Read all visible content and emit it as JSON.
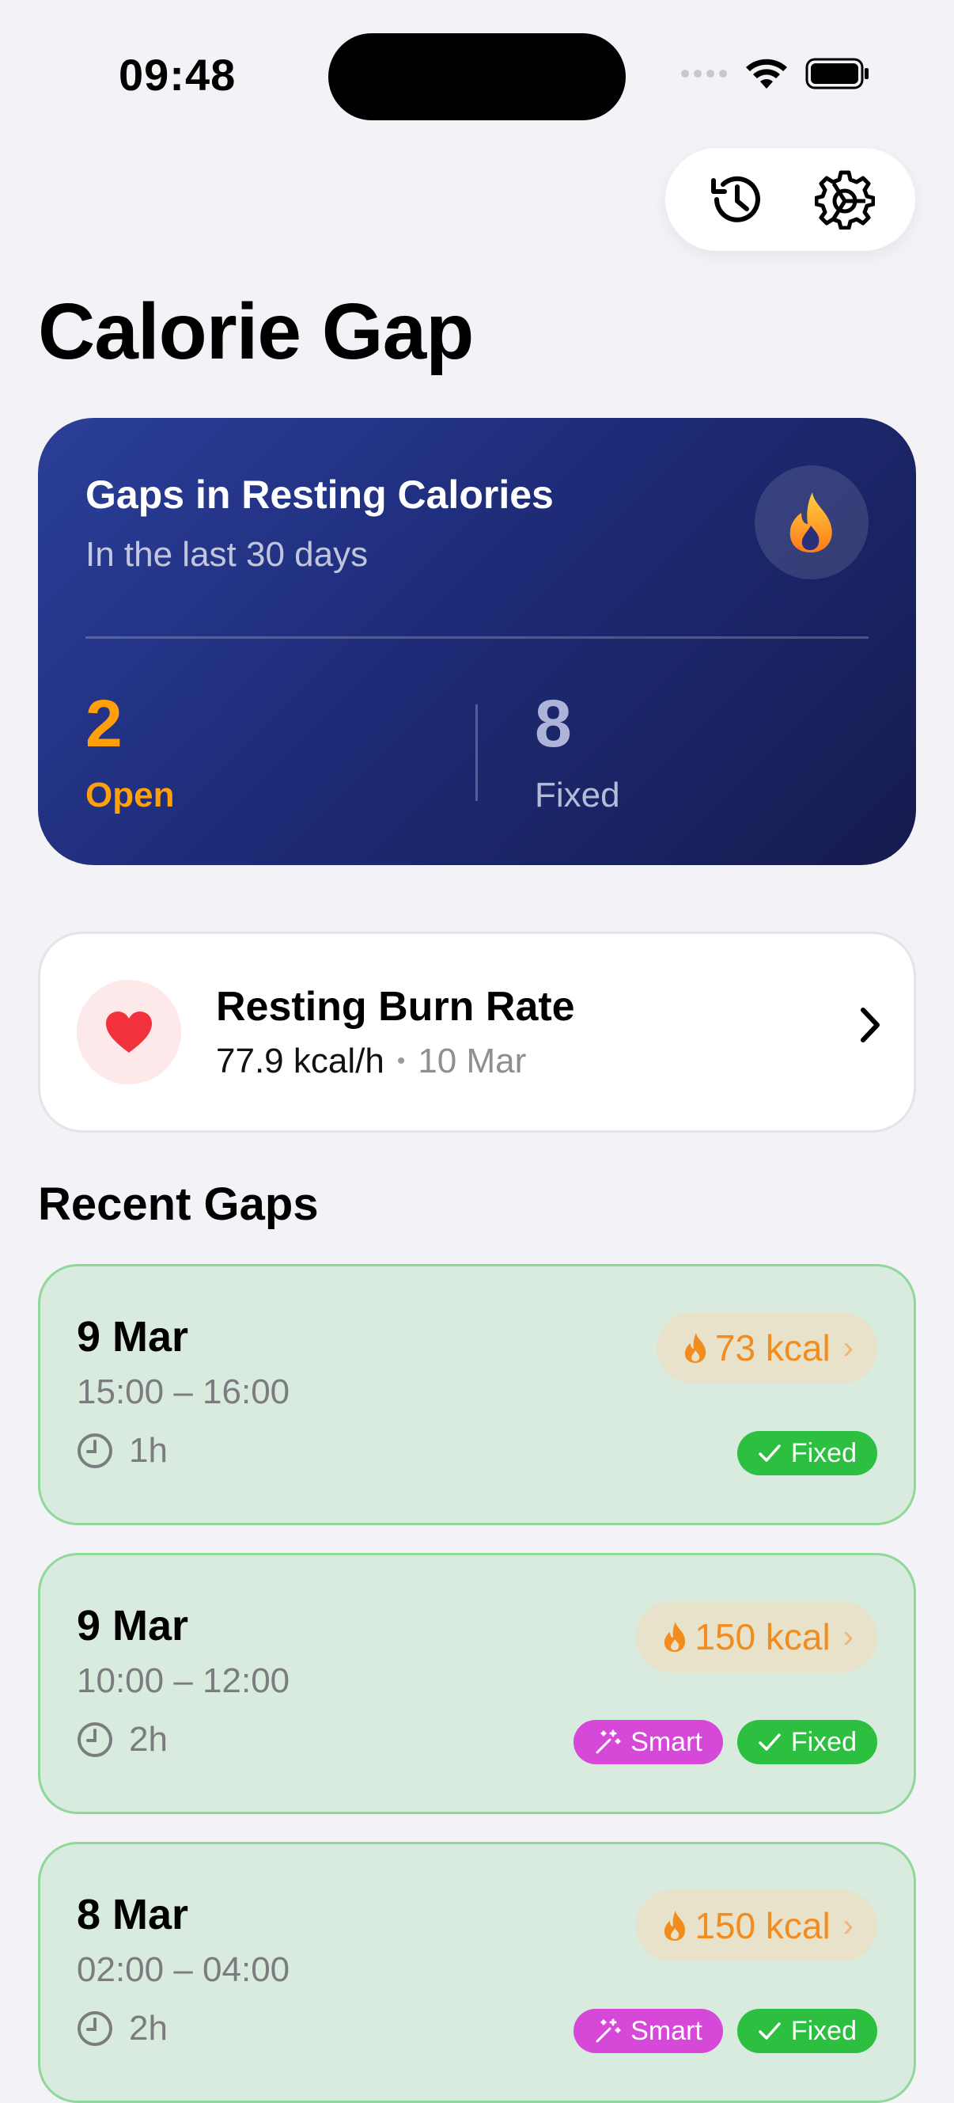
{
  "status_bar": {
    "time": "09:48"
  },
  "page": {
    "title": "Calorie Gap"
  },
  "summary": {
    "title": "Gaps in Resting Calories",
    "subtitle": "In the last 30 days",
    "open_value": "2",
    "open_label": "Open",
    "fixed_value": "8",
    "fixed_label": "Fixed"
  },
  "burn_rate": {
    "title": "Resting Burn Rate",
    "value": "77.9 kcal/h",
    "separator": "•",
    "date": "10 Mar"
  },
  "recent": {
    "title": "Recent Gaps",
    "items": [
      {
        "date": "9 Mar",
        "range": "15:00 – 16:00",
        "duration": "1h",
        "kcal": "73 kcal",
        "smart_label": "",
        "fixed_label": "Fixed"
      },
      {
        "date": "9 Mar",
        "range": "10:00 – 12:00",
        "duration": "2h",
        "kcal": "150 kcal",
        "smart_label": "Smart",
        "fixed_label": "Fixed"
      },
      {
        "date": "8 Mar",
        "range": "02:00 – 04:00",
        "duration": "2h",
        "kcal": "150 kcal",
        "smart_label": "Smart",
        "fixed_label": "Fixed"
      }
    ]
  },
  "colors": {
    "accent_orange": "#ff9f0a",
    "fixed_green": "#2dbf3f",
    "smart_purple": "#d548d8",
    "card_blue": "#1e2c78"
  },
  "icons": {
    "history": "history-icon",
    "settings": "gear-icon",
    "flame": "flame-icon",
    "heart": "heart-icon",
    "chevron": "chevron-right-icon",
    "clock": "clock-icon",
    "check": "checkmark-icon",
    "wand": "magic-wand-icon"
  }
}
